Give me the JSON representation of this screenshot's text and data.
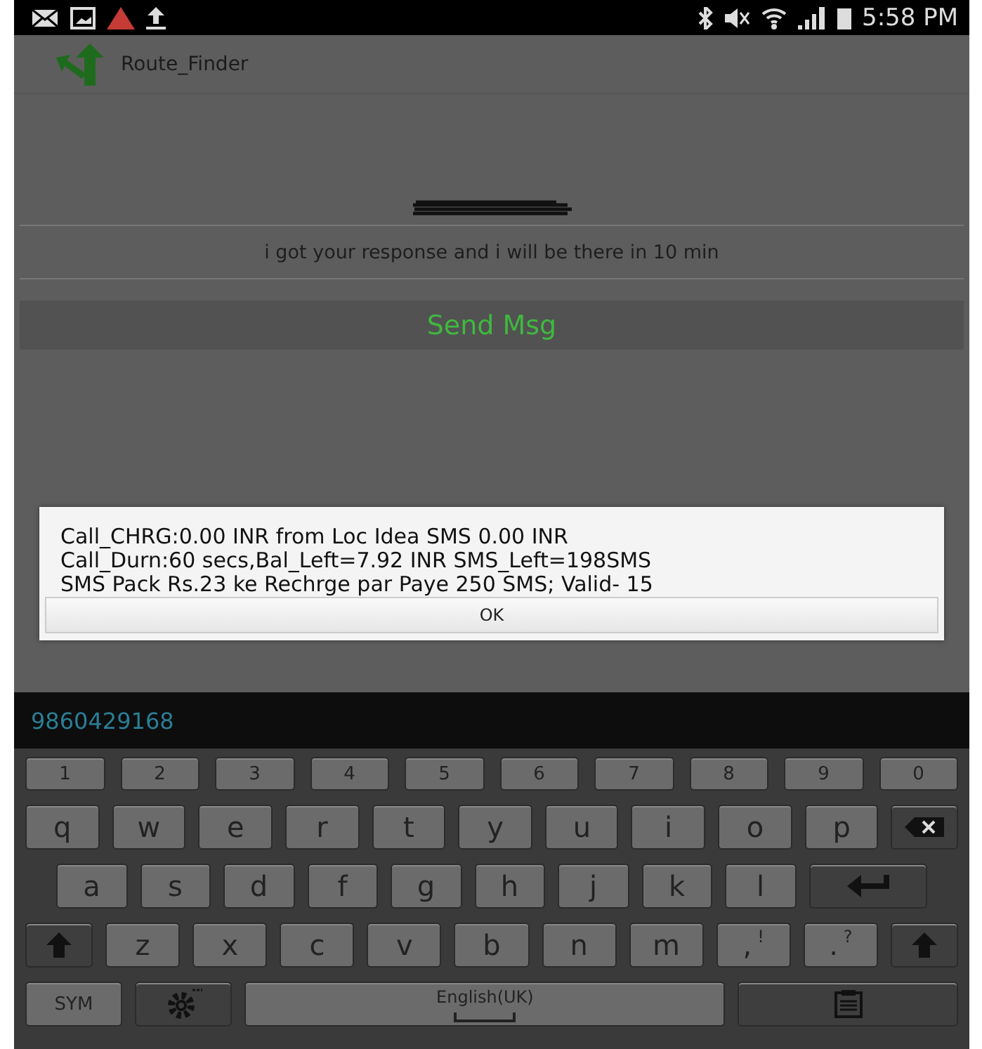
{
  "status_bar": {
    "time": "5:58 PM"
  },
  "app_bar": {
    "title": "Route_Finder"
  },
  "form": {
    "message": "i got your response and i will be there in 10 min",
    "send_button": "Send Msg"
  },
  "dialog": {
    "lines": [
      "Call_CHRG:0.00 INR from Loc Idea SMS 0.00 INR",
      "Call_Durn:60 secs,Bal_Left=7.92 INR SMS_Left=198SMS",
      "SMS Pack Rs.23 ke Rechrge par Paye 250 SMS; Valid- 15"
    ],
    "button": "OK"
  },
  "phone_number": "9860429168",
  "keyboard": {
    "rows": [
      {
        "keys": [
          {
            "kind": "digit",
            "label": "1"
          },
          {
            "kind": "digit",
            "label": "2"
          },
          {
            "kind": "digit",
            "label": "3"
          },
          {
            "kind": "digit",
            "label": "4"
          },
          {
            "kind": "digit",
            "label": "5"
          },
          {
            "kind": "digit",
            "label": "6"
          },
          {
            "kind": "digit",
            "label": "7"
          },
          {
            "kind": "digit",
            "label": "8"
          },
          {
            "kind": "digit",
            "label": "9"
          },
          {
            "kind": "digit",
            "label": "0"
          }
        ]
      },
      {
        "keys": [
          {
            "kind": "char",
            "label": "q"
          },
          {
            "kind": "char",
            "label": "w"
          },
          {
            "kind": "char",
            "label": "e"
          },
          {
            "kind": "char",
            "label": "r"
          },
          {
            "kind": "char",
            "label": "t"
          },
          {
            "kind": "char",
            "label": "y"
          },
          {
            "kind": "char",
            "label": "u"
          },
          {
            "kind": "char",
            "label": "i"
          },
          {
            "kind": "char",
            "label": "o"
          },
          {
            "kind": "char",
            "label": "p"
          },
          {
            "kind": "backspace"
          }
        ]
      },
      {
        "keys": [
          {
            "kind": "char",
            "label": "a"
          },
          {
            "kind": "char",
            "label": "s"
          },
          {
            "kind": "char",
            "label": "d"
          },
          {
            "kind": "char",
            "label": "f"
          },
          {
            "kind": "char",
            "label": "g"
          },
          {
            "kind": "char",
            "label": "h"
          },
          {
            "kind": "char",
            "label": "j"
          },
          {
            "kind": "char",
            "label": "k"
          },
          {
            "kind": "char",
            "label": "l"
          },
          {
            "kind": "enter"
          }
        ]
      },
      {
        "keys": [
          {
            "kind": "shift"
          },
          {
            "kind": "char",
            "label": "z"
          },
          {
            "kind": "char",
            "label": "x"
          },
          {
            "kind": "char",
            "label": "c"
          },
          {
            "kind": "char",
            "label": "v"
          },
          {
            "kind": "char",
            "label": "b"
          },
          {
            "kind": "char",
            "label": "n"
          },
          {
            "kind": "char",
            "label": "m"
          },
          {
            "kind": "punct",
            "label": ",",
            "alt": "!"
          },
          {
            "kind": "punct",
            "label": ".",
            "alt": "?"
          },
          {
            "kind": "shift"
          }
        ]
      },
      {
        "keys": [
          {
            "kind": "sym",
            "label": "SYM"
          },
          {
            "kind": "settings"
          },
          {
            "kind": "space",
            "label": "English(UK)"
          },
          {
            "kind": "clipboard"
          }
        ]
      }
    ]
  }
}
